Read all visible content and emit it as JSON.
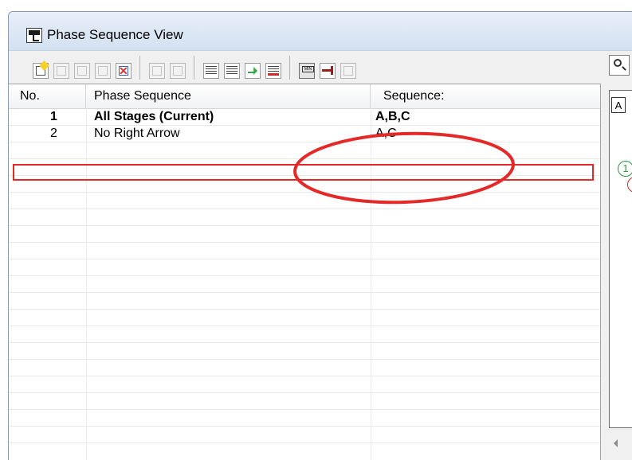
{
  "window": {
    "title": "Phase Sequence View"
  },
  "toolbar": {
    "buttons": [
      "new-sequence-icon",
      "disabled-icon-1",
      "disabled-icon-2",
      "disabled-delete-icon",
      "remove-icon",
      "disabled-icon-3",
      "disabled-icon-4",
      "list-edit-icon",
      "list-view-icon",
      "green-arrow-icon",
      "red-arrow-icon",
      "min-icon",
      "red-stop-icon",
      "disabled-icon-5"
    ],
    "zoom_icon": "magnifier-icon"
  },
  "table": {
    "headers": {
      "no": "No.",
      "phase_sequence": "Phase Sequence",
      "sequence": "Sequence:"
    },
    "rows": [
      {
        "no": "1",
        "phase_sequence": "All Stages (Current)",
        "sequence": "A,B,C"
      },
      {
        "no": "2",
        "phase_sequence": "No Right Arrow",
        "sequence": "A,C"
      }
    ]
  },
  "side_pane": {
    "tag": "A",
    "circle_label": "1"
  },
  "colors": {
    "highlight": "#e42929",
    "accent_green": "#2a9a3a"
  }
}
